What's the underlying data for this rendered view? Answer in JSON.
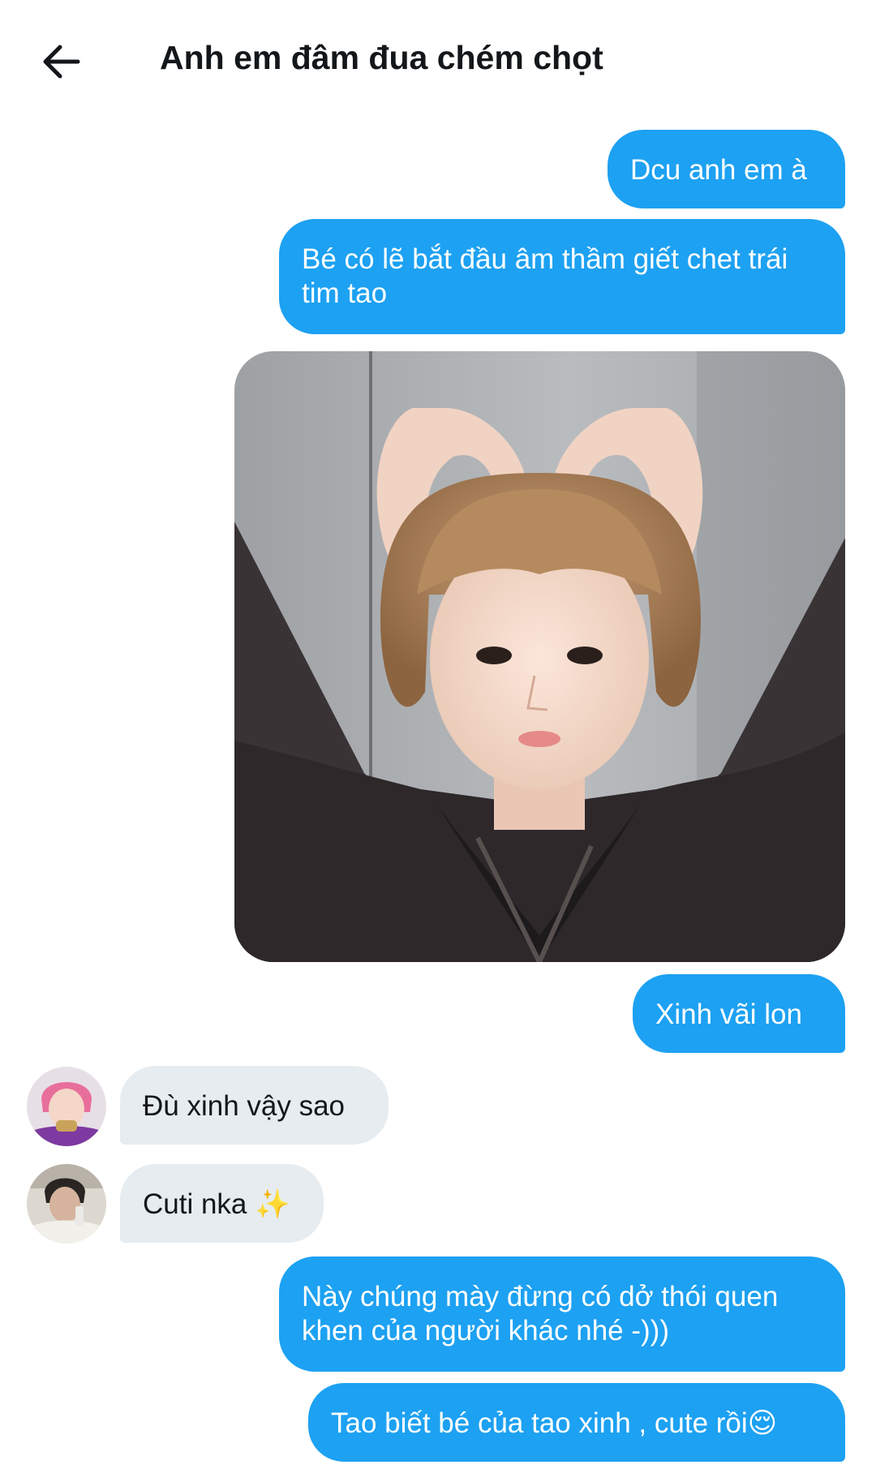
{
  "header": {
    "title": "Anh em đâm đua chém chọt"
  },
  "messages": [
    {
      "text": "Dcu anh em à"
    },
    {
      "text": "Bé có lẽ bắt đầu âm thầm giết chet trái tim tao"
    },
    {
      "text": "Xinh vãi lon"
    },
    {
      "text": "Đù xinh vậy sao"
    },
    {
      "text": "Cuti nka ✨"
    },
    {
      "text": "Này chúng mày đừng có dở thói quen khen của người khác nhé -)))"
    },
    {
      "text": "Tao biết bé của tao xinh , cute rồi😌"
    }
  ],
  "icons": {
    "back": "arrow-left-icon",
    "sparkles": "sparkles-icon",
    "emoji": "relieved-face-emoji"
  },
  "colors": {
    "outgoing": "#1da1f2",
    "incoming": "#e6ecf0",
    "title": "#14171a"
  }
}
